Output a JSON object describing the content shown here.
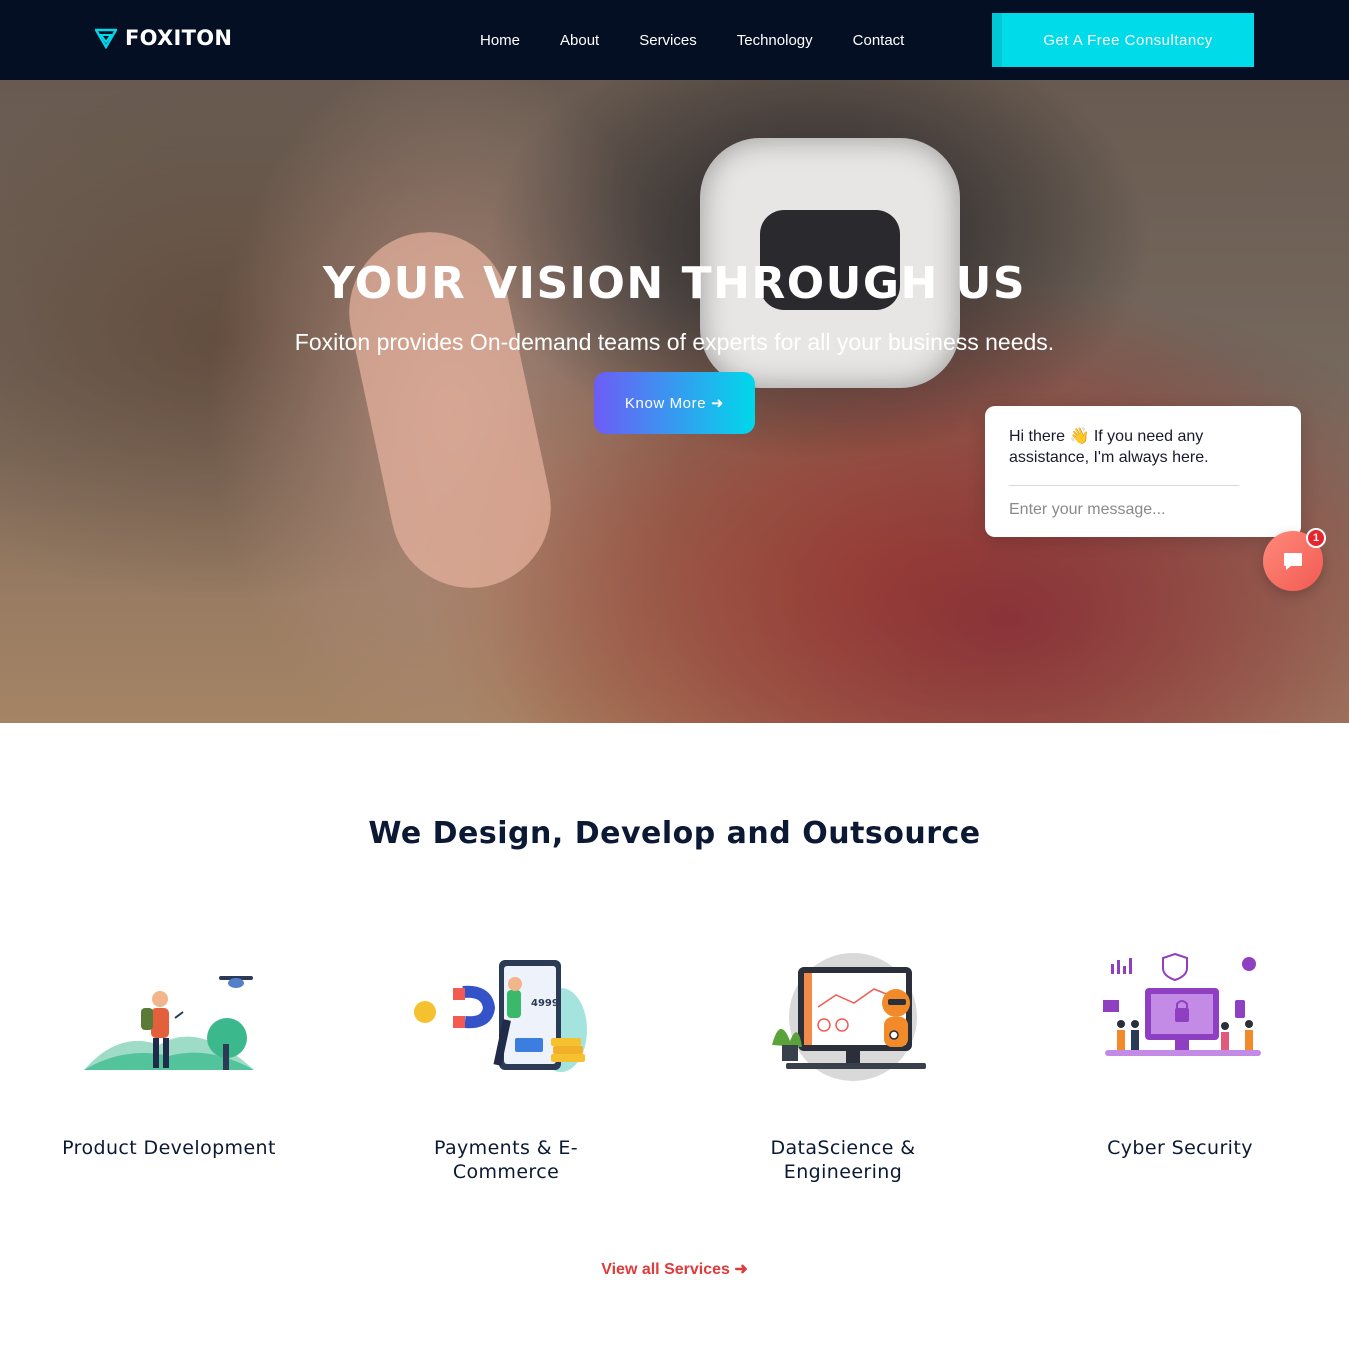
{
  "brand": {
    "name": "FOXITON",
    "logo_icon": "triangle-logo-icon",
    "accent": "#00dbe9",
    "nav_bg": "#050f24"
  },
  "nav": {
    "items": [
      {
        "label": "Home"
      },
      {
        "label": "About"
      },
      {
        "label": "Services"
      },
      {
        "label": "Technology"
      },
      {
        "label": "Contact"
      }
    ],
    "cta_label": "Get A Free Consultancy"
  },
  "hero": {
    "title": "YOUR VISION THROUGH US",
    "subtitle": "Foxiton provides On-demand teams of experts for all your business needs.",
    "button_label": "Know More ➜"
  },
  "chat": {
    "message": "Hi there 👋 If you need any assistance, I'm always here.",
    "input_placeholder": "Enter your message...",
    "badge_count": "1",
    "bubble_icon": "chat-bubble-icon",
    "bubble_color": "#f25a52"
  },
  "services": {
    "heading": "We Design, Develop and Outsource",
    "items": [
      {
        "title": "Product Development",
        "icon": "hiker-drone-illustration"
      },
      {
        "title": "Payments & E-Commerce",
        "icon": "magnet-phone-illustration"
      },
      {
        "title": "DataScience & Engineering",
        "icon": "robot-monitor-illustration"
      },
      {
        "title": "Cyber Security",
        "icon": "lock-monitor-illustration"
      }
    ],
    "view_all_label": "View all Services ➜",
    "view_all_color": "#e03a3a"
  }
}
